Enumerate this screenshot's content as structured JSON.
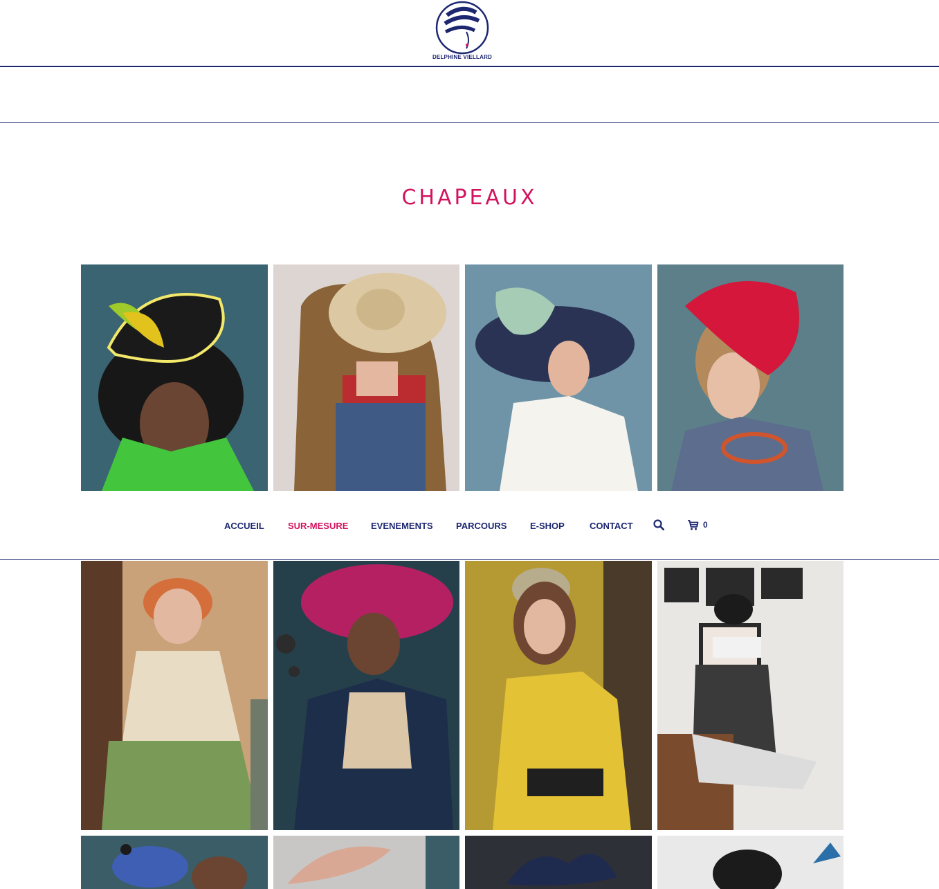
{
  "brand": {
    "name": "DELPHINE VIELLARD"
  },
  "page": {
    "title": "CHAPEAUX"
  },
  "nav": {
    "items": [
      {
        "label": "ACCUEIL",
        "active": false
      },
      {
        "label": "SUR-MESURE",
        "active": true
      },
      {
        "label": "EVENEMENTS",
        "active": false
      },
      {
        "label": "PARCOURS",
        "active": false
      },
      {
        "label": "E-SHOP",
        "active": false
      },
      {
        "label": "CONTACT",
        "active": false
      }
    ],
    "search_icon": "search-icon",
    "cart_icon": "cart-icon",
    "cart_count": "0"
  },
  "colors": {
    "brand_navy": "#1d2770",
    "accent_pink": "#d2135e"
  },
  "gallery": {
    "photos": [
      {
        "subject": "black ruffled hat with yellow-green feathers, green jacket"
      },
      {
        "subject": "wide straw hat, polka dot scarf, denim"
      },
      {
        "subject": "mint and navy sculpted wide hat, white blouse"
      },
      {
        "subject": "red sculpted lace fascinator, tweed jacket"
      },
      {
        "subject": "striped flat cap, cream blazer, plaid skirt"
      },
      {
        "subject": "fuchsia wide brim hat, denim jacket"
      },
      {
        "subject": "small beige pillbox hat, yellow cardigan"
      },
      {
        "subject": "black hat with polka dot clutch, striped dress"
      },
      {
        "subject": "blue flat cap"
      },
      {
        "subject": "pleated peach hat"
      },
      {
        "subject": "navy sculpted ribbon hat"
      },
      {
        "subject": "black textured hat"
      }
    ]
  }
}
